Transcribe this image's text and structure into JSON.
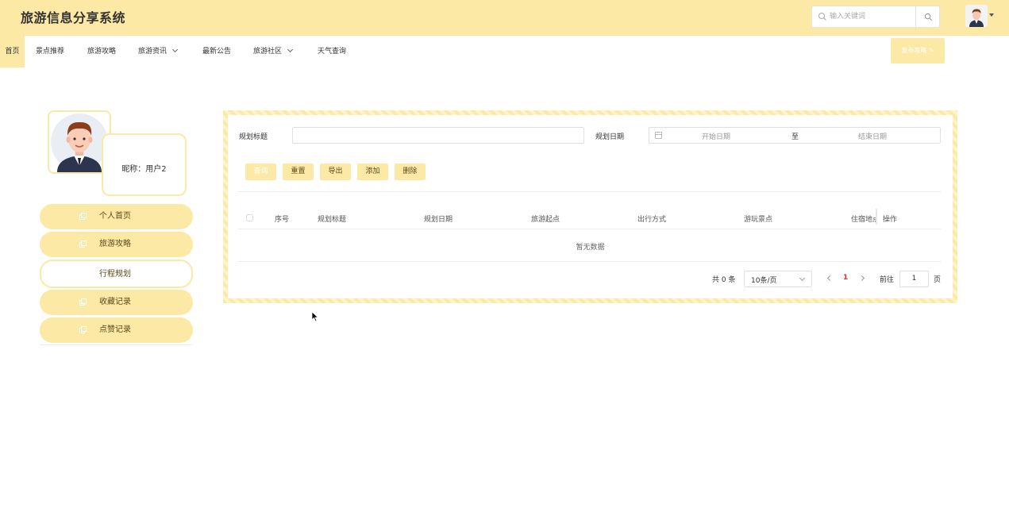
{
  "header": {
    "title": "旅游信息分享系统",
    "search_placeholder": "输入关键词"
  },
  "nav": {
    "items": [
      {
        "label": "首页",
        "active": true
      },
      {
        "label": "景点推荐"
      },
      {
        "label": "旅游攻略"
      },
      {
        "label": "旅游资讯",
        "dropdown": true
      },
      {
        "label": "最新公告"
      },
      {
        "label": "旅游社区",
        "dropdown": true
      },
      {
        "label": "天气查询"
      }
    ],
    "publish_label": "发布攻略"
  },
  "profile": {
    "nickname": "昵称：用户2"
  },
  "side_menu": [
    {
      "label": "个人首页"
    },
    {
      "label": "旅游攻略"
    },
    {
      "label": "行程规划",
      "active": true
    },
    {
      "label": "收藏记录"
    },
    {
      "label": "点赞记录"
    }
  ],
  "search_form": {
    "title_label": "规划标题",
    "title_value": "",
    "date_label": "规划日期",
    "start_placeholder": "开始日期",
    "range_separator": "至",
    "end_placeholder": "结束日期"
  },
  "actions": {
    "query": "查询",
    "reset": "重置",
    "export": "导出",
    "add": "添加",
    "delete": "删除"
  },
  "table": {
    "columns": [
      "序号",
      "规划标题",
      "规划日期",
      "旅游起点",
      "出行方式",
      "游玩景点",
      "住宿地点",
      "操作"
    ],
    "empty_text": "暂无数据"
  },
  "pagination": {
    "total_text": "共 0 条",
    "page_size": "10条/页",
    "current_page": "1",
    "goto_label": "前往",
    "goto_value": "1",
    "page_suffix": "页"
  },
  "colors": {
    "accent": "#fde9a6",
    "page_active": "#e03030"
  }
}
